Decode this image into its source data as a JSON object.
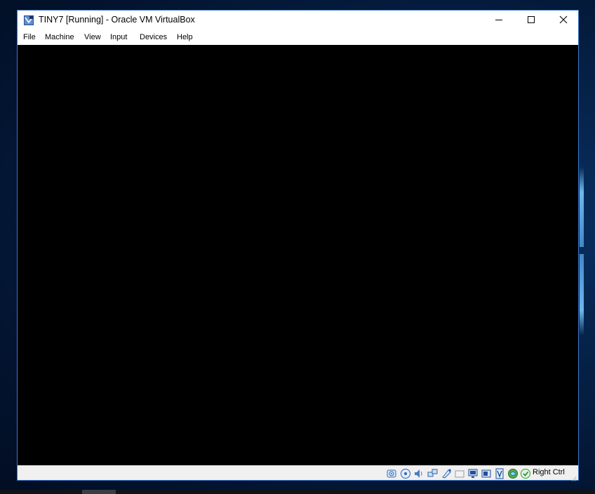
{
  "window": {
    "title": "TINY7 [Running] - Oracle VM VirtualBox",
    "app_icon": "virtualbox-icon",
    "controls": {
      "minimize": "minimize-icon",
      "maximize": "maximize-icon",
      "close": "close-icon"
    }
  },
  "menubar": {
    "items": [
      "File",
      "Machine",
      "View",
      "Input",
      "Devices",
      "Help"
    ]
  },
  "statusbar": {
    "icons": [
      "hard-disk-icon",
      "optical-drive-icon",
      "audio-icon",
      "network-icon",
      "usb-icon",
      "shared-folders-icon",
      "display-icon",
      "recording-icon",
      "cpu-indicator-icon",
      "mouse-integration-icon",
      "keyboard-capture-icon"
    ],
    "host_key": "Right Ctrl"
  },
  "colors": {
    "vm_screen": "#000000",
    "window_border": "#3c78c8",
    "desktop": "#031634"
  }
}
